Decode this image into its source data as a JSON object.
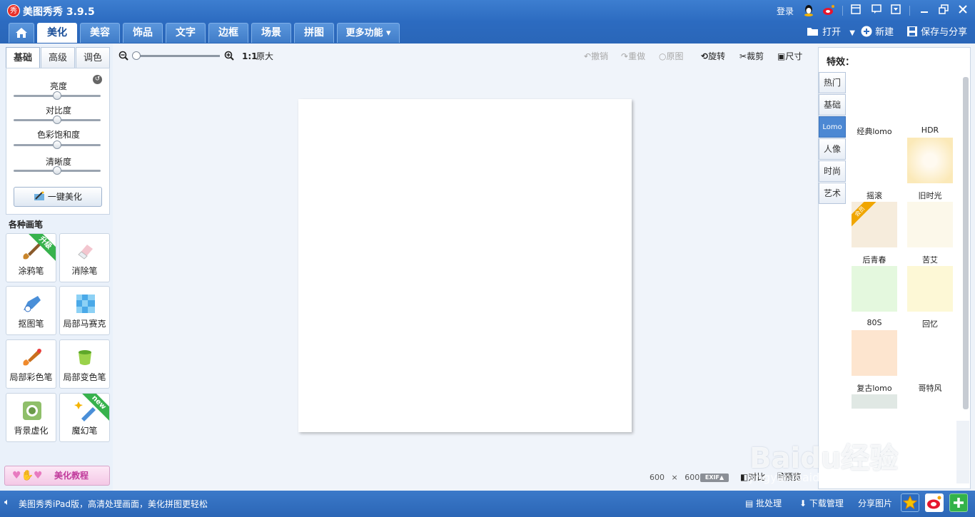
{
  "app": {
    "logo_text": "秀",
    "title": "美图秀秀 3.9.5",
    "login": "登录"
  },
  "tabs": [
    "美化",
    "美容",
    "饰品",
    "文字",
    "边框",
    "场景",
    "拼图",
    "更多功能 ▾"
  ],
  "header_actions": {
    "open": "打开",
    "new": "新建",
    "save": "保存与分享"
  },
  "left": {
    "subtabs": [
      "基础",
      "高级",
      "调色"
    ],
    "sliders": [
      {
        "label": "亮度",
        "value": 0.5
      },
      {
        "label": "对比度",
        "value": 0.5
      },
      {
        "label": "色彩饱和度",
        "value": 0.5
      },
      {
        "label": "清晰度",
        "value": 0.5
      }
    ],
    "onekey": "一键美化",
    "brush_title": "各种画笔",
    "brushes": [
      {
        "label": "涂鸦笔",
        "badge": "升级"
      },
      {
        "label": "消除笔",
        "badge": ""
      },
      {
        "label": "抠图笔",
        "badge": ""
      },
      {
        "label": "局部马赛克",
        "badge": ""
      },
      {
        "label": "局部彩色笔",
        "badge": ""
      },
      {
        "label": "局部变色笔",
        "badge": ""
      },
      {
        "label": "背景虚化",
        "badge": ""
      },
      {
        "label": "魔幻笔",
        "badge": "new"
      }
    ],
    "tutorial": "美化教程"
  },
  "canvas": {
    "zoom_label": "1:1",
    "original_size": "原大",
    "tools": {
      "undo": "撤销",
      "redo": "重做",
      "original": "原图",
      "rotate": "旋转",
      "crop": "裁剪",
      "size": "尺寸"
    },
    "image_width": "600",
    "times": "×",
    "image_height": "600",
    "exif": "EXIF▲",
    "compare": "对比",
    "preview": "预览"
  },
  "effects": {
    "title": "特效：",
    "tabs": [
      "热门",
      "基础",
      "Lomo",
      "人像",
      "时尚",
      "艺术"
    ],
    "active_tab": "Lomo",
    "items": [
      {
        "label": "经典lomo",
        "color": "#ffffff"
      },
      {
        "label": "HDR",
        "color": "#fbe9b8"
      },
      {
        "label": "摇滚",
        "color": "#f6ecdc",
        "badge": "会员"
      },
      {
        "label": "旧时光",
        "color": "#fcf8ea"
      },
      {
        "label": "后青春",
        "color": "#e4f8de"
      },
      {
        "label": "苦艾",
        "color": "#fdf8d6"
      },
      {
        "label": "80S",
        "color": "#fde5cf"
      },
      {
        "label": "回忆",
        "color": "#ffffff"
      },
      {
        "label": "复古lomo",
        "color": "#e0e8e4"
      },
      {
        "label": "哥特风",
        "color": "#ffffff"
      }
    ]
  },
  "status": {
    "text": "美图秀秀iPad版，高清处理画面，美化拼图更轻松",
    "batch": "批处理",
    "download": "下载管理",
    "share": "分享图片"
  },
  "watermark": {
    "brand": "Baidu经验",
    "url": "jingyan.baidu.com"
  },
  "colors": {
    "titlebar": "#2c6bc0",
    "accent": "#4c88d3",
    "tutorial": "#c0399b"
  }
}
